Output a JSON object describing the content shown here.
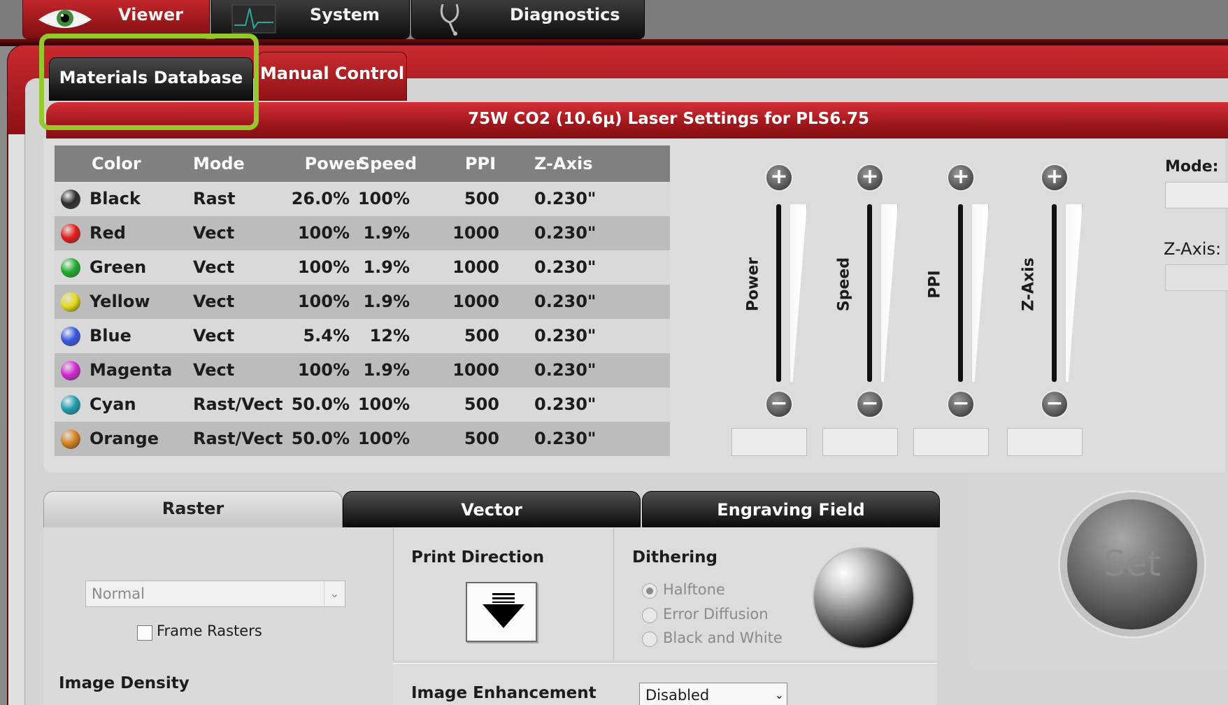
{
  "top_tabs": [
    {
      "label": "Viewer",
      "icon": "eye-icon",
      "active": true
    },
    {
      "label": "System",
      "icon": "waveform-icon",
      "active": false
    },
    {
      "label": "Diagnostics",
      "icon": "stethoscope-icon",
      "active": false
    }
  ],
  "sub_tabs": [
    {
      "label": "Materials Database",
      "active": true
    },
    {
      "label": "Manual Control",
      "active": false
    }
  ],
  "banner": "75W CO2 (10.6µ) Laser Settings for PLS6.75",
  "table": {
    "headers": [
      "Color",
      "Mode",
      "Power",
      "Speed",
      "PPI",
      "Z-Axis"
    ],
    "rows": [
      {
        "color": "Black",
        "swatch": "#2a2a2a",
        "mode": "Rast",
        "power": "26.0%",
        "speed": "100%",
        "ppi": "500",
        "z": "0.230\""
      },
      {
        "color": "Red",
        "swatch": "#e81919",
        "mode": "Vect",
        "power": "100%",
        "speed": "1.9%",
        "ppi": "1000",
        "z": "0.230\""
      },
      {
        "color": "Green",
        "swatch": "#1cae2a",
        "mode": "Vect",
        "power": "100%",
        "speed": "1.9%",
        "ppi": "1000",
        "z": "0.230\""
      },
      {
        "color": "Yellow",
        "swatch": "#e4dc14",
        "mode": "Vect",
        "power": "100%",
        "speed": "1.9%",
        "ppi": "1000",
        "z": "0.230\""
      },
      {
        "color": "Blue",
        "swatch": "#3655e6",
        "mode": "Vect",
        "power": "5.4%",
        "speed": "12%",
        "ppi": "500",
        "z": "0.230\""
      },
      {
        "color": "Magenta",
        "swatch": "#d728d6",
        "mode": "Vect",
        "power": "100%",
        "speed": "1.9%",
        "ppi": "1000",
        "z": "0.230\""
      },
      {
        "color": "Cyan",
        "swatch": "#1a9fae",
        "mode": "Rast/Vect",
        "power": "50.0%",
        "speed": "100%",
        "ppi": "500",
        "z": "0.230\""
      },
      {
        "color": "Orange",
        "swatch": "#d9801a",
        "mode": "Rast/Vect",
        "power": "50.0%",
        "speed": "100%",
        "ppi": "500",
        "z": "0.230\""
      }
    ]
  },
  "sliders": [
    {
      "label": "Power",
      "plus": "+",
      "minus": "−"
    },
    {
      "label": "Speed",
      "plus": "+",
      "minus": "−"
    },
    {
      "label": "PPI",
      "plus": "+",
      "minus": "−"
    },
    {
      "label": "Z-Axis",
      "plus": "+",
      "minus": "−"
    }
  ],
  "right": {
    "mode_label": "Mode:",
    "zaxis_label": "Z-Axis:",
    "set_label": "Set"
  },
  "bottom_tabs": [
    {
      "label": "Raster",
      "active": true
    },
    {
      "label": "Vector",
      "active": false
    },
    {
      "label": "Engraving Field",
      "active": false
    }
  ],
  "raster": {
    "mode_select": "Normal",
    "frame_rasters": "Frame Rasters",
    "image_density": "Image Density"
  },
  "print_direction": {
    "label": "Print Direction",
    "icon": "down-arrow-icon"
  },
  "dithering": {
    "label": "Dithering",
    "options": [
      {
        "label": "Halftone",
        "selected": true
      },
      {
        "label": "Error Diffusion",
        "selected": false
      },
      {
        "label": "Black and White",
        "selected": false
      }
    ]
  },
  "enhancement": {
    "label": "Image Enhancement",
    "value": "Disabled"
  },
  "colors": {
    "accent_red": "#b31c21",
    "highlight_green": "#93c92a"
  }
}
